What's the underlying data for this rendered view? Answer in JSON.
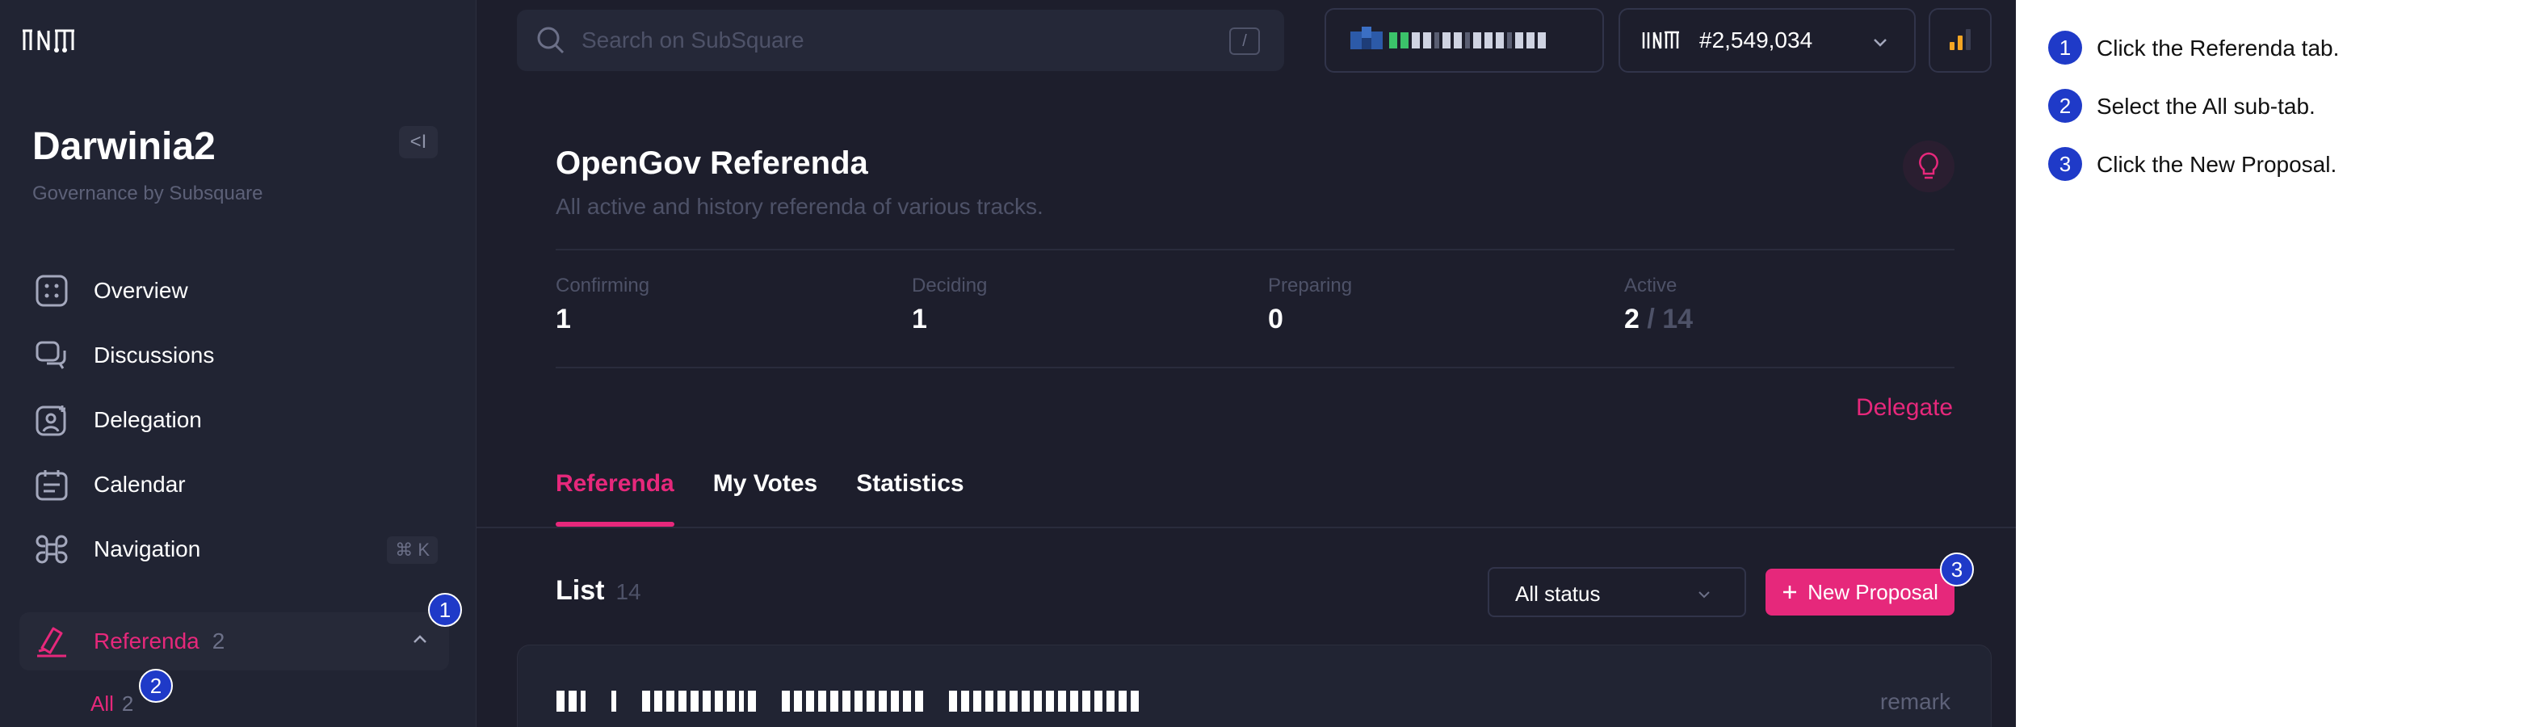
{
  "sidebar": {
    "brand": {
      "name": "Darwinia2",
      "subtitle": "Governance by Subsquare"
    },
    "collapse_label": "<I",
    "items": [
      {
        "label": "Overview",
        "icon": "overview-icon"
      },
      {
        "label": "Discussions",
        "icon": "discussions-icon"
      },
      {
        "label": "Delegation",
        "icon": "delegation-icon"
      },
      {
        "label": "Calendar",
        "icon": "calendar-icon"
      },
      {
        "label": "Navigation",
        "icon": "command-icon",
        "shortcut": "⌘ K"
      }
    ],
    "referenda": {
      "label": "Referenda",
      "count": "2"
    },
    "sub_items": [
      {
        "label": "All",
        "count": "2"
      }
    ]
  },
  "topbar": {
    "search_placeholder": "Search on SubSquare",
    "search_shortcut": "/",
    "block_number": "#2,549,034"
  },
  "main": {
    "title": "OpenGov Referenda",
    "subtitle": "All active and history referenda of various tracks.",
    "stats": [
      {
        "label": "Confirming",
        "value": "1"
      },
      {
        "label": "Deciding",
        "value": "1"
      },
      {
        "label": "Preparing",
        "value": "0"
      },
      {
        "label": "Active",
        "value": "2",
        "total": " / 14"
      }
    ],
    "delegate_label": "Delegate",
    "tabs": [
      {
        "label": "Referenda"
      },
      {
        "label": "My Votes"
      },
      {
        "label": "Statistics"
      }
    ],
    "list": {
      "title": "List",
      "count": "14",
      "status_filter": "All status",
      "new_proposal_label": "New Proposal",
      "first_item_tag": "remark"
    }
  },
  "badges": {
    "b1": "1",
    "b2": "2",
    "b3": "3"
  },
  "instructions": [
    {
      "num": "1",
      "text": "Click the Referenda tab."
    },
    {
      "num": "2",
      "text": "Select the All sub-tab."
    },
    {
      "num": "3",
      "text": "Click the New Proposal."
    }
  ],
  "colors": {
    "accent": "#e6287b",
    "background": "#1d1e2c",
    "sidebar": "#212433",
    "badge": "#1f3ac8",
    "signal": "#f5a623"
  }
}
